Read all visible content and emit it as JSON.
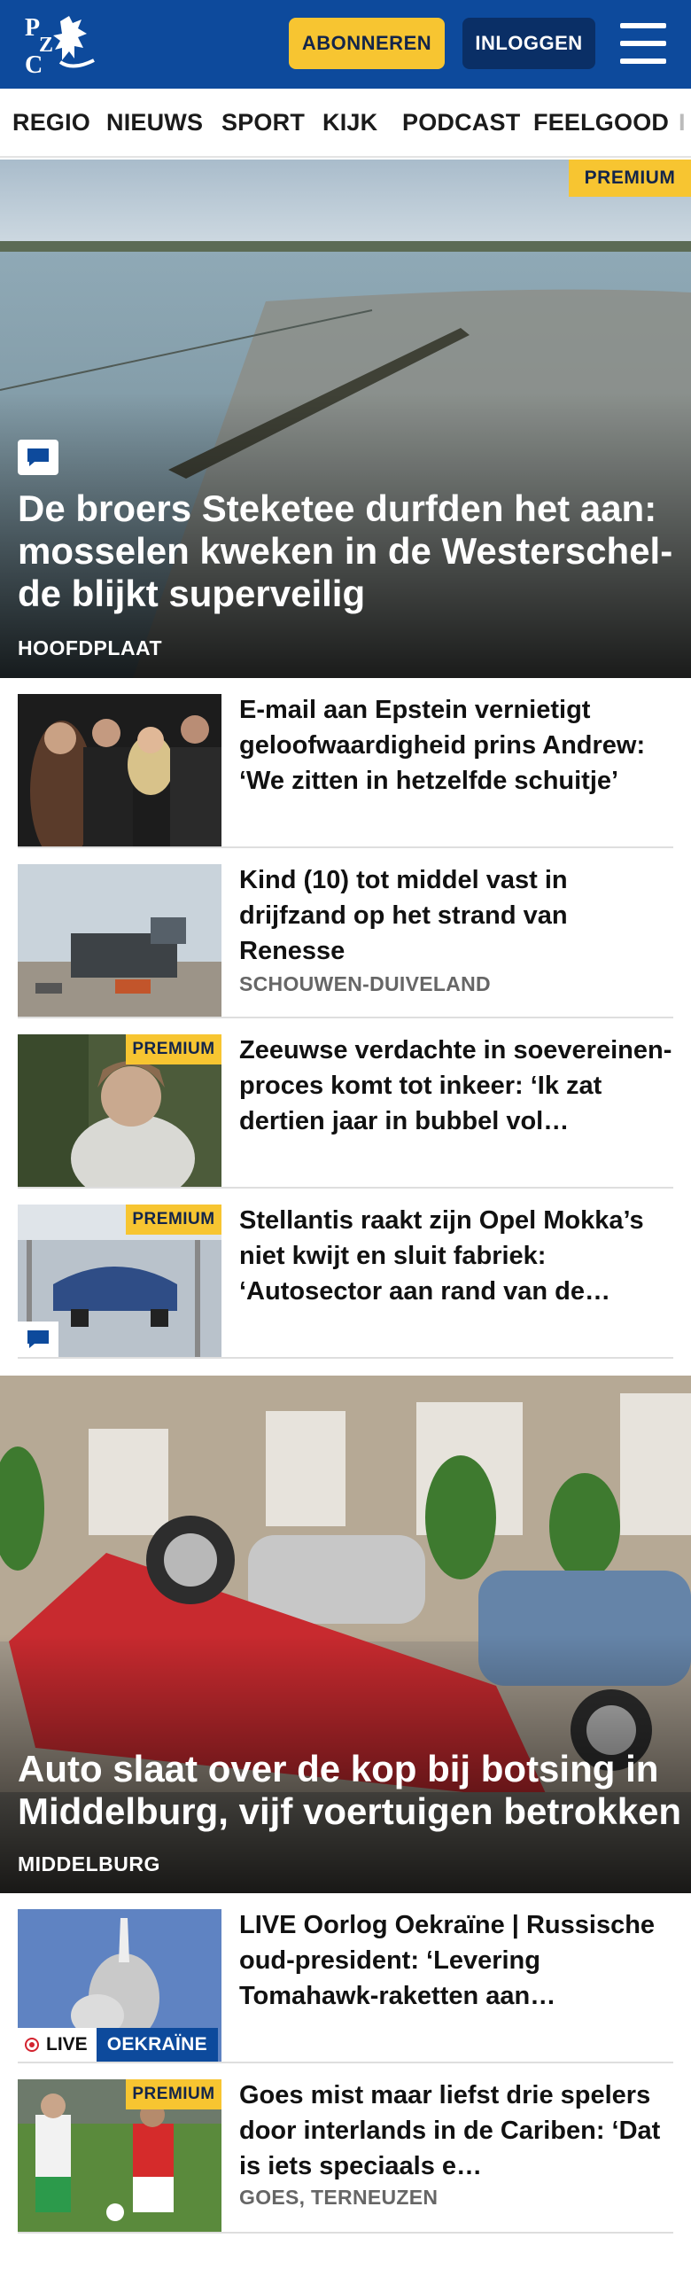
{
  "header": {
    "logo_text": "PZC",
    "subscribe_label": "ABONNEREN",
    "login_label": "INLOGGEN",
    "colors": {
      "brand": "#0d4a9c",
      "accent": "#f7c531"
    }
  },
  "nav": {
    "items": [
      "REGIO",
      "NIEUWS",
      "SPORT",
      "KIJK",
      "PODCAST",
      "FEELGOOD",
      "I"
    ]
  },
  "hero": {
    "premium_label": "PREMIUM",
    "title": "De broers Steketee durfden het aan: mosselen kweken in de Westerschel­de blijkt superveilig",
    "location": "HOOFDPLAAT",
    "has_comments": true
  },
  "articles": [
    {
      "title": "E-mail aan Epstein vernietigt geloofwaardigheid prins Andrew: ‘We zitten in hetzelfde schuitje’"
    },
    {
      "title": "Kind (10) tot middel vast in drijfzand op het strand van Renesse",
      "location": "SCHOUWEN-DUIVELAND"
    },
    {
      "premium_label": "PREMIUM",
      "title": "Zeeuwse verdachte in soeverei­nen-proces komt tot inkeer: ‘Ik zat dertien jaar in bubbel vol…"
    },
    {
      "premium_label": "PREMIUM",
      "title": "Stellantis raakt zijn Opel Mokka’s niet kwijt en sluit fabriek: ‘Autosector aan rand van de…"
    }
  ],
  "hero2": {
    "title": "Auto slaat over de kop bij botsing in Middelburg, vijf voertuigen betrokken",
    "location": "MIDDELBURG"
  },
  "articles2": [
    {
      "live_label": "LIVE",
      "topic_label": "OEKRAÏNE",
      "title": "LIVE Oorlog Oekraïne | Russische oud-president: ‘Levering Tomahawk-raketten aan…"
    },
    {
      "premium_label": "PREMIUM",
      "title": "Goes mist maar liefst drie spelers door interlands in de Cariben: ‘Dat is iets speciaals e…",
      "location": "GOES, TERNEUZEN"
    }
  ]
}
